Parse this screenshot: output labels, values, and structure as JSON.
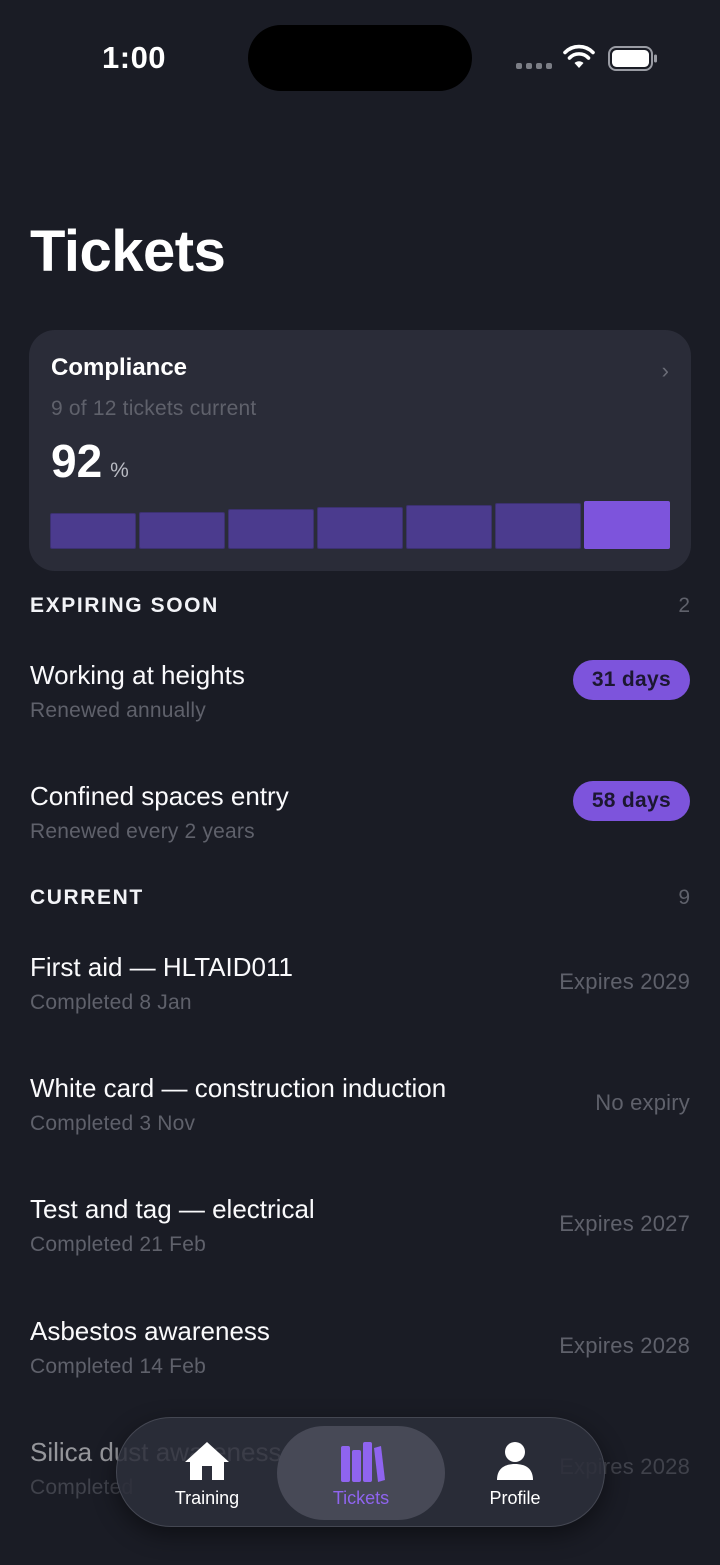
{
  "status": {
    "time": "1:00"
  },
  "title": "Tickets",
  "compliance": {
    "title": "Compliance",
    "subtitle": "9 of 12 tickets current",
    "value": "92",
    "unit": "%",
    "bar_levels": [
      0.7,
      0.72,
      0.76,
      0.8,
      0.84,
      0.88,
      0.93
    ],
    "colors": {
      "accent": "#7d54dc",
      "muted_bar": "#4b3b8e"
    }
  },
  "expiring": {
    "label": "EXPIRING SOON",
    "count": "2",
    "items": [
      {
        "title": "Working at heights",
        "sub": "Renewed annually",
        "badge": "31 days"
      },
      {
        "title": "Confined spaces entry",
        "sub": "Renewed every 2 years",
        "badge": "58 days"
      }
    ]
  },
  "current": {
    "label": "CURRENT",
    "count": "9",
    "items": [
      {
        "title": "First aid — HLTAID011",
        "sub": "Completed 8 Jan",
        "right": "Expires 2029"
      },
      {
        "title": "White card — construction induction",
        "sub": "Completed 3 Nov",
        "right": "No expiry"
      },
      {
        "title": "Test and tag — electrical",
        "sub": "Completed 21 Feb",
        "right": "Expires 2027"
      },
      {
        "title": "Asbestos awareness",
        "sub": "Completed 14 Feb",
        "right": "Expires 2028"
      },
      {
        "title": "Silica dust awareness",
        "sub": "Completed",
        "right": "Expires 2028"
      }
    ]
  },
  "tabs": [
    {
      "label": "Training",
      "icon": "house-icon",
      "active": false
    },
    {
      "label": "Tickets",
      "icon": "books-icon",
      "active": true
    },
    {
      "label": "Profile",
      "icon": "person-icon",
      "active": false
    }
  ]
}
